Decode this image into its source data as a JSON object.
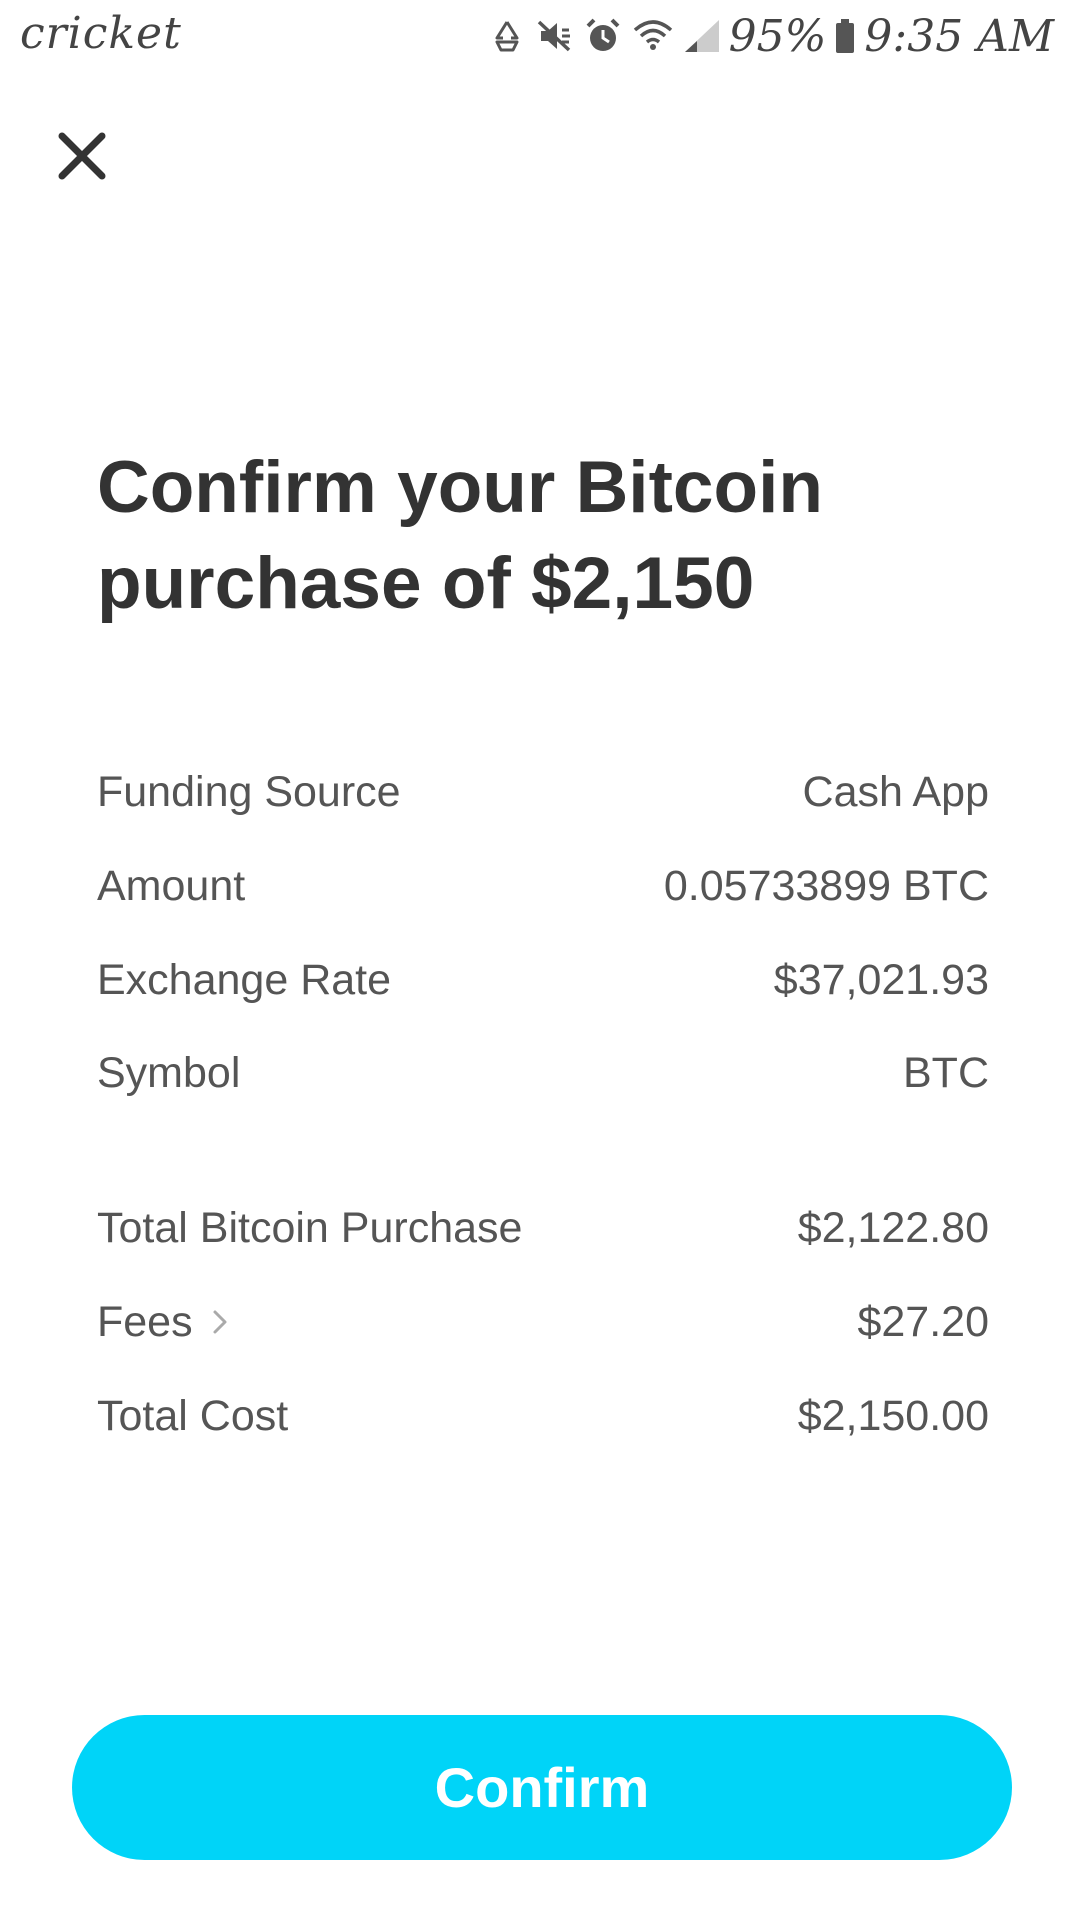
{
  "status_bar": {
    "carrier": "cricket",
    "battery_percent": "95%",
    "time": "9:35 AM"
  },
  "colors": {
    "accent": "#00d4f8",
    "text_primary": "#333333",
    "text_secondary": "#555555",
    "background": "#ffffff"
  },
  "title": {
    "line1": "Confirm your Bitcoin",
    "line2": "purchase of $2,150"
  },
  "details": [
    {
      "label": "Funding Source",
      "value": "Cash App"
    },
    {
      "label": "Amount",
      "value": "0.05733899 BTC"
    },
    {
      "label": "Exchange Rate",
      "value": "$37,021.93"
    },
    {
      "label": "Symbol",
      "value": "BTC"
    }
  ],
  "totals": [
    {
      "label": "Total Bitcoin Purchase",
      "value": "$2,122.80"
    },
    {
      "label": "Fees",
      "value": "$27.20"
    },
    {
      "label": "Total Cost",
      "value": "$2,150.00"
    }
  ],
  "confirm_label": "Confirm",
  "icons": {
    "close": "close-icon",
    "fees_chevron": "chevron-right-icon"
  }
}
